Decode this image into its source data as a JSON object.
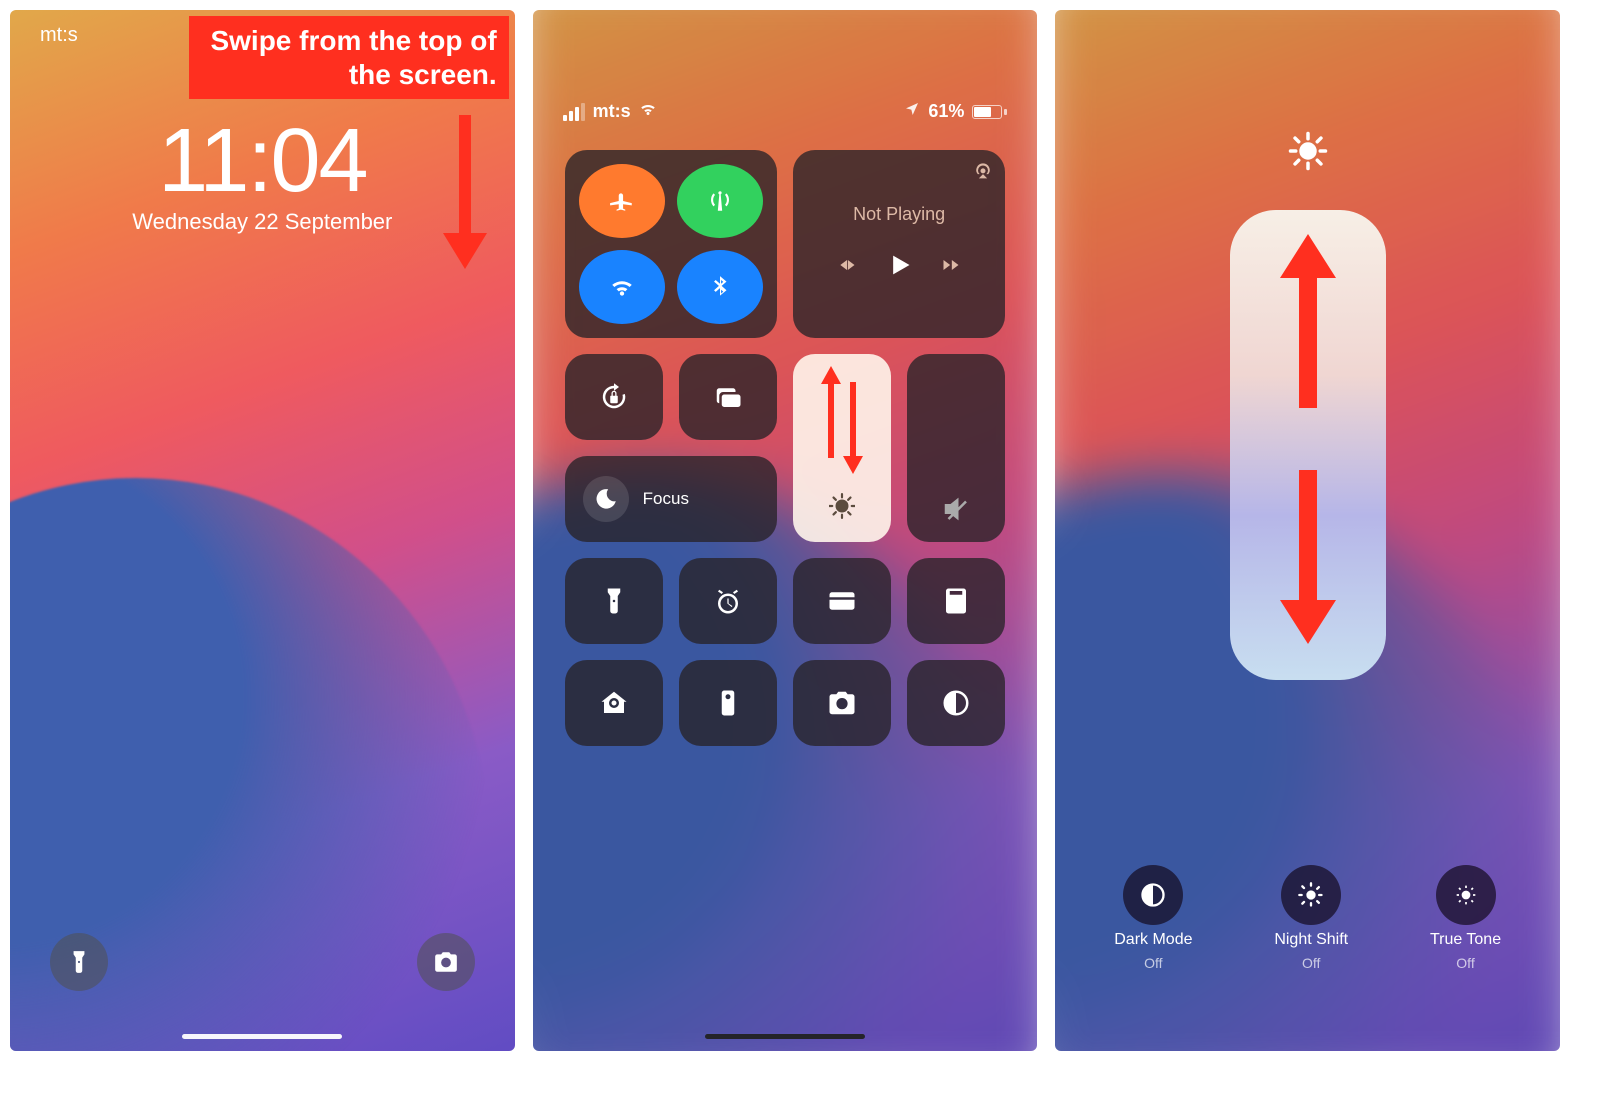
{
  "panel1": {
    "carrier": "mt:s",
    "time": "11:04",
    "date": "Wednesday 22 September",
    "annotation": "Swipe from the top of the screen."
  },
  "panel2": {
    "status": {
      "carrier": "mt:s",
      "battery_text": "61%"
    },
    "media": {
      "label": "Not Playing"
    },
    "focus": {
      "label": "Focus"
    }
  },
  "panel3": {
    "options": [
      {
        "name": "Dark Mode",
        "state": "Off"
      },
      {
        "name": "Night Shift",
        "state": "Off"
      },
      {
        "name": "True Tone",
        "state": "Off"
      }
    ]
  }
}
